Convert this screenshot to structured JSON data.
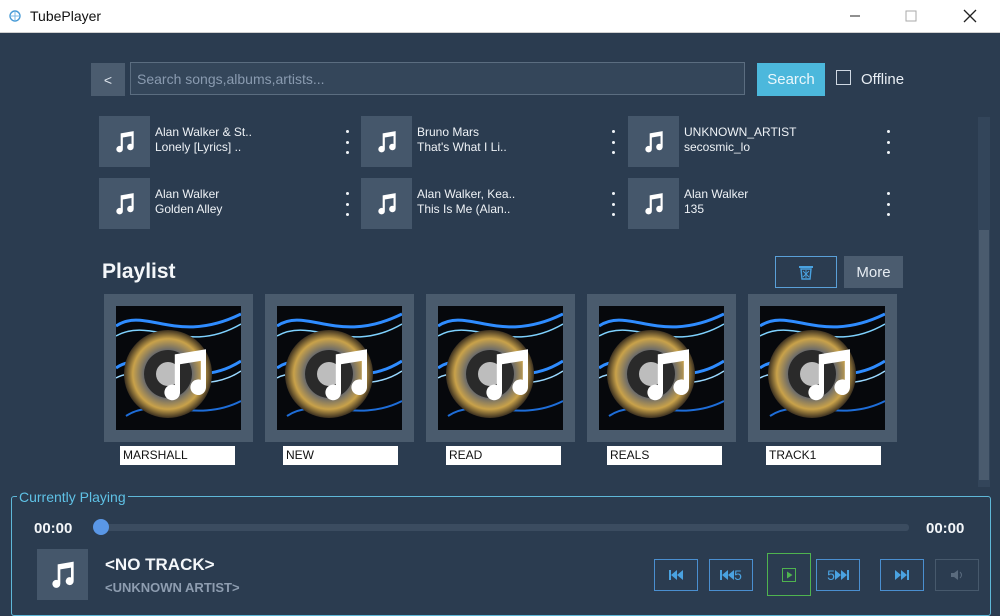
{
  "app": {
    "title": "TubePlayer"
  },
  "window_controls": {
    "minimize_icon": "minimize-icon",
    "maximize_icon": "maximize-icon",
    "close_icon": "close-icon"
  },
  "search": {
    "back_label": "<",
    "placeholder": "Search songs,albums,artists...",
    "value": "",
    "button_label": "Search",
    "offline_label": "Offline",
    "offline_checked": false
  },
  "results": [
    {
      "artist": "Alan Walker & St..",
      "title": "Lonely [Lyrics] .."
    },
    {
      "artist": "Bruno Mars",
      "title": "That's What I Li.."
    },
    {
      "artist": "UNKNOWN_ARTIST",
      "title": "secosmic_lo"
    },
    {
      "artist": "Alan Walker",
      "title": "Golden Alley"
    },
    {
      "artist": "Alan Walker, Kea..",
      "title": "This Is Me (Alan.."
    },
    {
      "artist": "Alan Walker",
      "title": "135"
    }
  ],
  "playlist": {
    "heading": "Playlist",
    "more_label": "More",
    "delete_icon": "trash-icon",
    "items": [
      {
        "name": "MARSHALL"
      },
      {
        "name": "NEW"
      },
      {
        "name": "READ"
      },
      {
        "name": "REALS"
      },
      {
        "name": "TRACK1"
      }
    ]
  },
  "player": {
    "section_label": "Currently Playing",
    "elapsed": "00:00",
    "duration": "00:00",
    "progress": 0,
    "track_title": "<NO TRACK>",
    "track_artist": "<UNKNOWN ARTIST>",
    "controls": [
      {
        "name": "previous-track-button",
        "icon": "skip-back-icon",
        "label": ""
      },
      {
        "name": "rewind-5-button",
        "icon": "rewind-icon",
        "label": "5"
      },
      {
        "name": "play-button",
        "icon": "play-icon",
        "label": ""
      },
      {
        "name": "forward-5-button",
        "icon": "fast-forward-icon",
        "label": "5"
      },
      {
        "name": "next-track-button",
        "icon": "skip-forward-icon",
        "label": ""
      },
      {
        "name": "volume-button",
        "icon": "volume-icon",
        "label": ""
      }
    ]
  },
  "colors": {
    "background": "#2b3c50",
    "accent": "#4cb8dc",
    "play_border": "#4fb34f",
    "seek_fill": "#4c8fe0"
  }
}
